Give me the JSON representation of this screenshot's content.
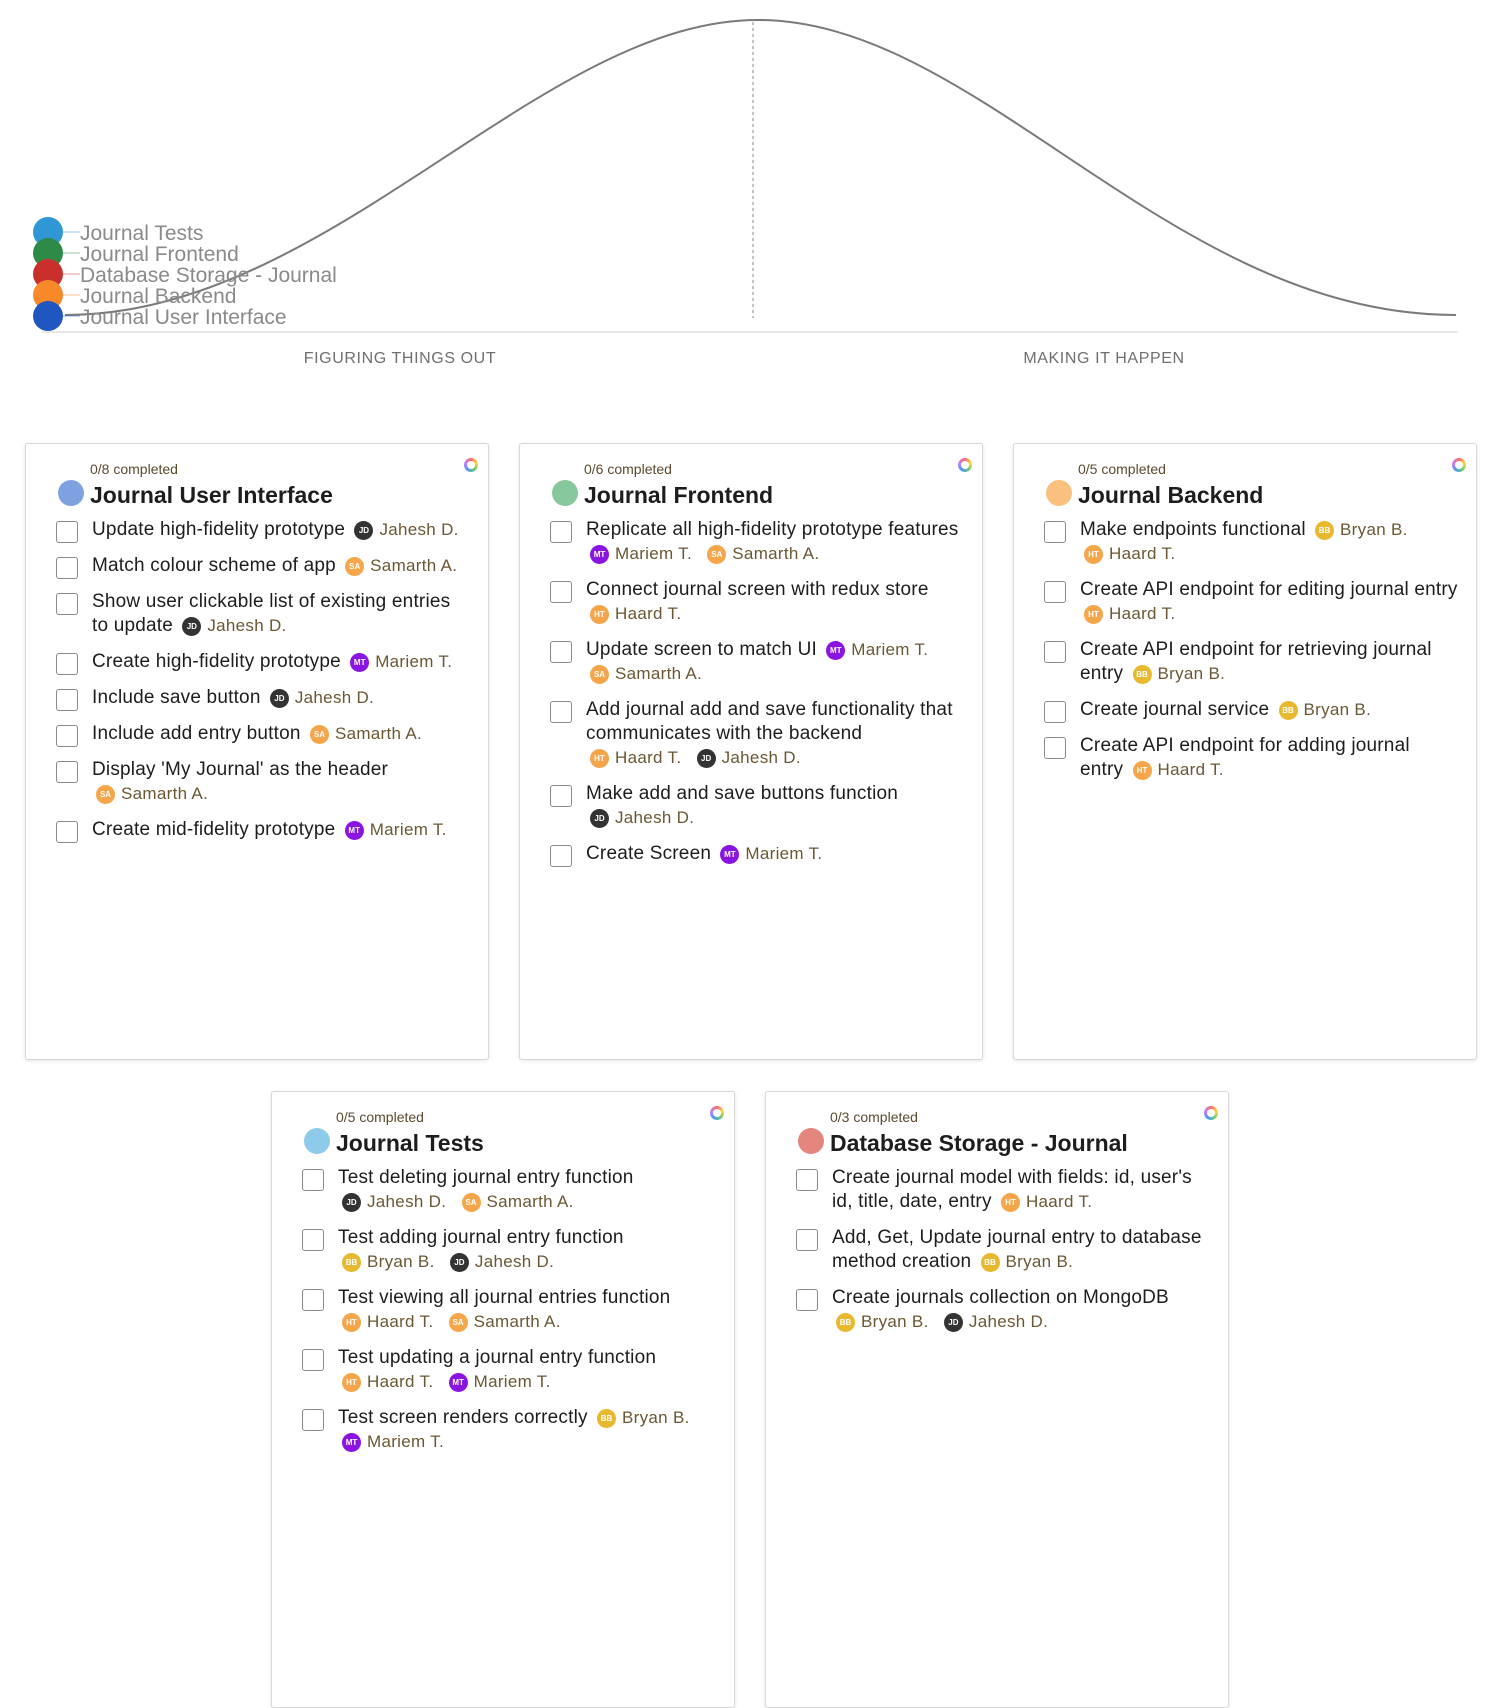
{
  "hill": {
    "phases": [
      "FIGURING THINGS OUT",
      "MAKING IT HAPPEN"
    ],
    "dots": [
      {
        "label": "Journal Tests",
        "color": "#2f97d6"
      },
      {
        "label": "Journal Frontend",
        "color": "#2e8b47"
      },
      {
        "label": "Database Storage - Journal",
        "color": "#c9302c"
      },
      {
        "label": "Journal Backend",
        "color": "#f7892b"
      },
      {
        "label": "Journal User Interface",
        "color": "#1f56bf"
      }
    ]
  },
  "avatars": {
    "JD": "#333333",
    "SA": "#f5a54a",
    "MT": "#8a14e0",
    "HT": "#f5a54a",
    "BB": "#e8b82e"
  },
  "cards": [
    {
      "count": "0/8 completed",
      "title": "Journal User Interface",
      "color": "#7ea2e0",
      "tasks": [
        {
          "text": "Update high-fidelity prototype",
          "assignees": [
            {
              "initials": "JD",
              "name": "Jahesh D."
            }
          ]
        },
        {
          "text": "Match colour scheme of app",
          "assignees": [
            {
              "initials": "SA",
              "name": "Samarth A."
            }
          ]
        },
        {
          "text": "Show user clickable list of existing entries to update",
          "assignees": [
            {
              "initials": "JD",
              "name": "Jahesh D."
            }
          ]
        },
        {
          "text": "Create high-fidelity prototype",
          "assignees": [
            {
              "initials": "MT",
              "name": "Mariem T."
            }
          ]
        },
        {
          "text": "Include save button",
          "assignees": [
            {
              "initials": "JD",
              "name": "Jahesh D."
            }
          ]
        },
        {
          "text": "Include add entry button",
          "assignees": [
            {
              "initials": "SA",
              "name": "Samarth A."
            }
          ]
        },
        {
          "text": "Display 'My Journal' as the header",
          "assignees": [
            {
              "initials": "SA",
              "name": "Samarth A."
            }
          ]
        },
        {
          "text": "Create mid-fidelity prototype",
          "assignees": [
            {
              "initials": "MT",
              "name": "Mariem T."
            }
          ]
        }
      ]
    },
    {
      "count": "0/6 completed",
      "title": "Journal Frontend",
      "color": "#86c89b",
      "tasks": [
        {
          "text": "Replicate all high-fidelity prototype features",
          "assignees": [
            {
              "initials": "MT",
              "name": "Mariem T."
            },
            {
              "initials": "SA",
              "name": "Samarth A."
            }
          ]
        },
        {
          "text": "Connect journal screen with redux store",
          "assignees": [
            {
              "initials": "HT",
              "name": "Haard T."
            }
          ]
        },
        {
          "text": "Update screen to match UI",
          "assignees": [
            {
              "initials": "MT",
              "name": "Mariem T."
            },
            {
              "initials": "SA",
              "name": "Samarth A."
            }
          ]
        },
        {
          "text": "Add journal add and save functionality that communicates with the backend",
          "assignees": [
            {
              "initials": "HT",
              "name": "Haard T."
            },
            {
              "initials": "JD",
              "name": "Jahesh D."
            }
          ]
        },
        {
          "text": "Make add and save buttons function",
          "assignees": [
            {
              "initials": "JD",
              "name": "Jahesh D."
            }
          ]
        },
        {
          "text": "Create Screen",
          "assignees": [
            {
              "initials": "MT",
              "name": "Mariem T."
            }
          ]
        }
      ]
    },
    {
      "count": "0/5 completed",
      "title": "Journal Backend",
      "color": "#f9c07e",
      "tasks": [
        {
          "text": "Make endpoints functional",
          "assignees": [
            {
              "initials": "BB",
              "name": "Bryan B."
            },
            {
              "initials": "HT",
              "name": "Haard T."
            }
          ]
        },
        {
          "text": "Create API endpoint for editing journal entry",
          "assignees": [
            {
              "initials": "HT",
              "name": "Haard T."
            }
          ]
        },
        {
          "text": "Create API endpoint for retrieving journal entry",
          "assignees": [
            {
              "initials": "BB",
              "name": "Bryan B."
            }
          ]
        },
        {
          "text": "Create journal service",
          "assignees": [
            {
              "initials": "BB",
              "name": "Bryan B."
            }
          ]
        },
        {
          "text": "Create API endpoint for adding journal entry",
          "assignees": [
            {
              "initials": "HT",
              "name": "Haard T."
            }
          ]
        }
      ]
    },
    {
      "count": "0/5 completed",
      "title": "Journal Tests",
      "color": "#8ecbea",
      "tasks": [
        {
          "text": "Test deleting journal entry function",
          "assignees": [
            {
              "initials": "JD",
              "name": "Jahesh D."
            },
            {
              "initials": "SA",
              "name": "Samarth A."
            }
          ]
        },
        {
          "text": "Test adding journal entry function",
          "assignees": [
            {
              "initials": "BB",
              "name": "Bryan B."
            },
            {
              "initials": "JD",
              "name": "Jahesh D."
            }
          ]
        },
        {
          "text": "Test viewing all journal entries function",
          "assignees": [
            {
              "initials": "HT",
              "name": "Haard T."
            },
            {
              "initials": "SA",
              "name": "Samarth A."
            }
          ]
        },
        {
          "text": "Test updating a journal entry function",
          "assignees": [
            {
              "initials": "HT",
              "name": "Haard T."
            },
            {
              "initials": "MT",
              "name": "Mariem T."
            }
          ]
        },
        {
          "text": "Test screen renders correctly",
          "assignees": [
            {
              "initials": "BB",
              "name": "Bryan B."
            },
            {
              "initials": "MT",
              "name": "Mariem T."
            }
          ]
        }
      ]
    },
    {
      "count": "0/3 completed",
      "title": "Database Storage - Journal",
      "color": "#e4857e",
      "tasks": [
        {
          "text": "Create journal model with fields: id, user's id, title, date, entry",
          "assignees": [
            {
              "initials": "HT",
              "name": "Haard T."
            }
          ]
        },
        {
          "text": "Add, Get, Update journal entry to database method creation",
          "assignees": [
            {
              "initials": "BB",
              "name": "Bryan B."
            }
          ]
        },
        {
          "text": "Create journals collection on MongoDB",
          "assignees": [
            {
              "initials": "BB",
              "name": "Bryan B."
            },
            {
              "initials": "JD",
              "name": "Jahesh D."
            }
          ]
        }
      ]
    }
  ]
}
